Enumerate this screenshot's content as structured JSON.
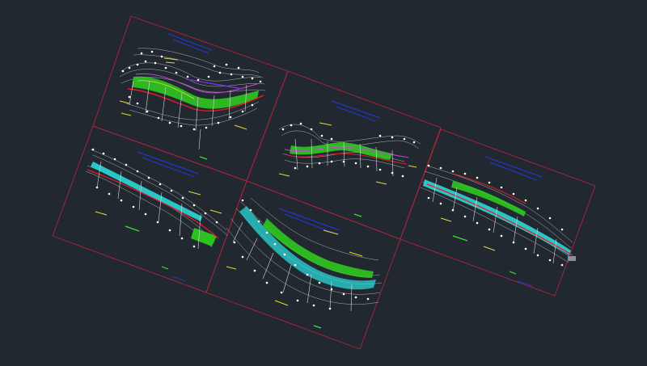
{
  "app": {
    "view": "model-space",
    "background_color": "#212830"
  },
  "colors": {
    "sheet_border": "#b0253a",
    "title_text": "#2436c8",
    "contour": "#c9ccd2",
    "survey_point": "#ffffff",
    "fill_green": "#2fd11f",
    "fill_cyan": "#2bd7d7",
    "line_red": "#e01d2a",
    "line_magenta": "#c04ad6",
    "label_yellow": "#e6d93a",
    "label_green": "#3fe03a"
  },
  "sheets": [
    {
      "name": "sheet-top-left",
      "fill": "green",
      "river": "red"
    },
    {
      "name": "sheet-top-center",
      "fill": "green",
      "river": "magenta"
    },
    {
      "name": "sheet-bottom-left",
      "fill": "cyan",
      "river": "red"
    },
    {
      "name": "sheet-bottom-center",
      "fill": "cyan",
      "river": "green"
    },
    {
      "name": "sheet-right",
      "fill": "cyan",
      "river": "red"
    }
  ]
}
